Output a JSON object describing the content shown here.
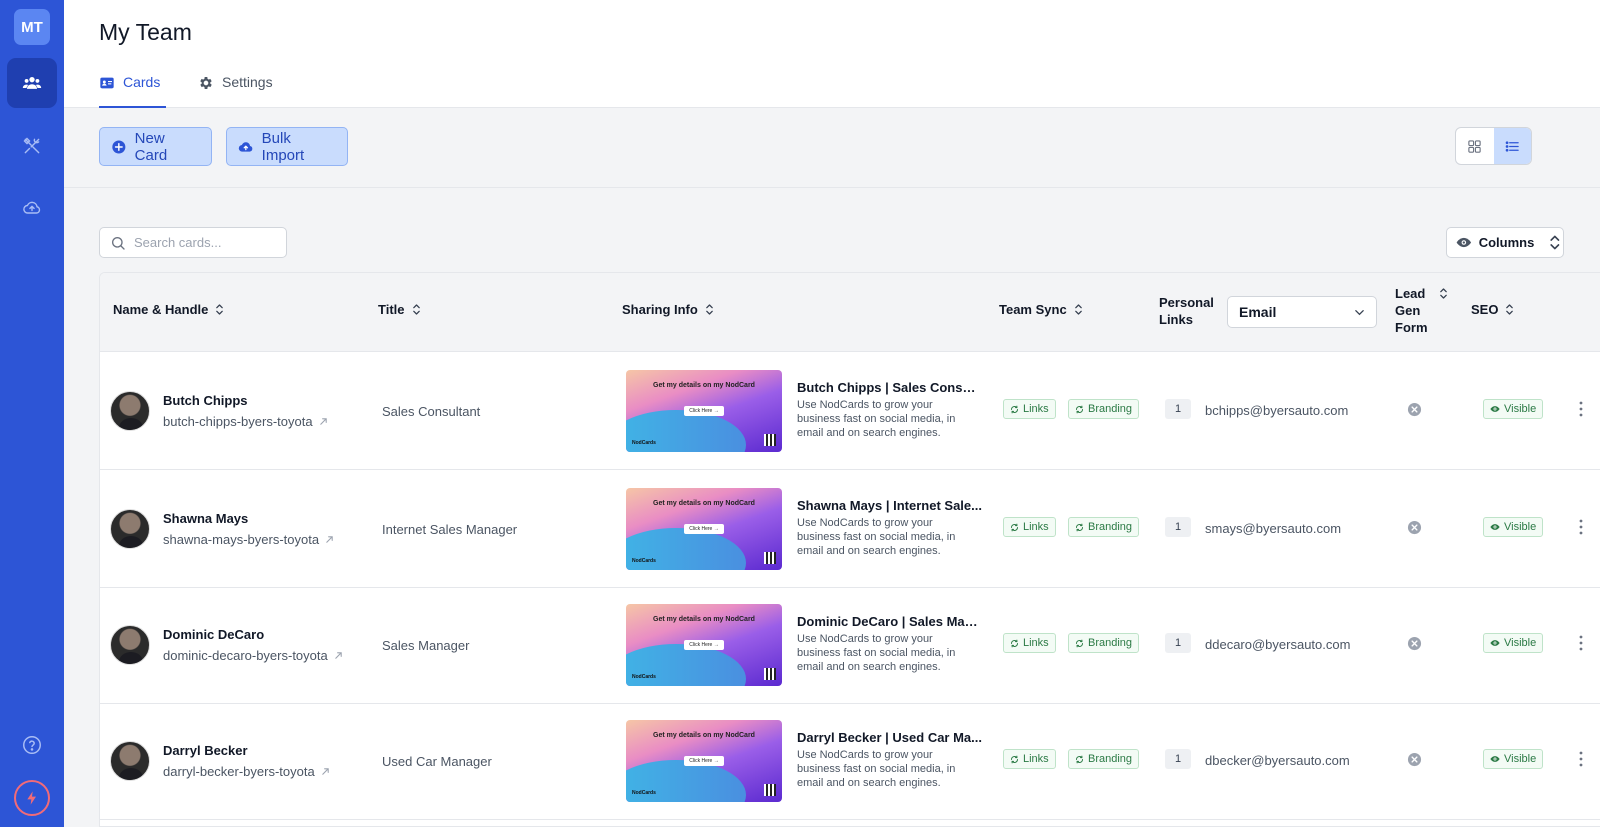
{
  "sidebar": {
    "logo": "MT",
    "items": [
      {
        "icon": "users-icon",
        "active": true
      },
      {
        "icon": "tools-icon",
        "active": false
      },
      {
        "icon": "cloud-upload-icon",
        "active": false
      }
    ],
    "help_icon": "help-icon",
    "bolt_icon": "bolt-icon"
  },
  "header": {
    "title": "My Team",
    "tabs": [
      {
        "label": "Cards",
        "icon": "id-card-icon",
        "active": true
      },
      {
        "label": "Settings",
        "icon": "gear-icon",
        "active": false
      }
    ]
  },
  "toolbar": {
    "new_card_label": "New Card",
    "bulk_import_label": "Bulk Import",
    "view_mode": "list"
  },
  "search": {
    "placeholder": "Search cards...",
    "value": ""
  },
  "columns_label": "Columns",
  "table": {
    "headers": {
      "name": "Name & Handle",
      "title": "Title",
      "sharing": "Sharing Info",
      "team_sync": "Team Sync",
      "personal_links_1": "Personal",
      "personal_links_2": "Links",
      "personal_links_select": "Email",
      "lead_gen_1": "Lead",
      "lead_gen_2": "Gen",
      "lead_gen_3": "Form",
      "seo": "SEO"
    },
    "thumb": {
      "headline": "Get my details on my NodCard",
      "cta": "Click Here →",
      "brand": "NodCards"
    },
    "pills": {
      "links": "Links",
      "branding": "Branding",
      "visible": "Visible"
    },
    "rows": [
      {
        "name": "Butch Chipps",
        "handle": "butch-chipps-byers-toyota",
        "title": "Sales Consultant",
        "share_title": "Butch Chipps | Sales Consult...",
        "share_desc": "Use NodCards to grow your business fast on social media, in email and on search engines.",
        "links_count": "1",
        "email": "bchipps@byersauto.com"
      },
      {
        "name": "Shawna Mays",
        "handle": "shawna-mays-byers-toyota",
        "title": "Internet Sales Manager",
        "share_title": "Shawna Mays | Internet Sale...",
        "share_desc": "Use NodCards to grow your business fast on social media, in email and on search engines.",
        "links_count": "1",
        "email": "smays@byersauto.com"
      },
      {
        "name": "Dominic DeCaro",
        "handle": "dominic-decaro-byers-toyota",
        "title": "Sales Manager",
        "share_title": "Dominic DeCaro | Sales Man...",
        "share_desc": "Use NodCards to grow your business fast on social media, in email and on search engines.",
        "links_count": "1",
        "email": "ddecaro@byersauto.com"
      },
      {
        "name": "Darryl Becker",
        "handle": "darryl-becker-byers-toyota",
        "title": "Used Car Manager",
        "share_title": "Darryl Becker | Used Car Ma...",
        "share_desc": "Use NodCards to grow your business fast on social media, in email and on search engines.",
        "links_count": "1",
        "email": "dbecker@byersauto.com"
      }
    ]
  },
  "colors": {
    "primary": "#2d55d6",
    "sidebar_active": "#1f3fb0",
    "button_bg": "#c9dcfd",
    "success": "#2b7a45"
  }
}
